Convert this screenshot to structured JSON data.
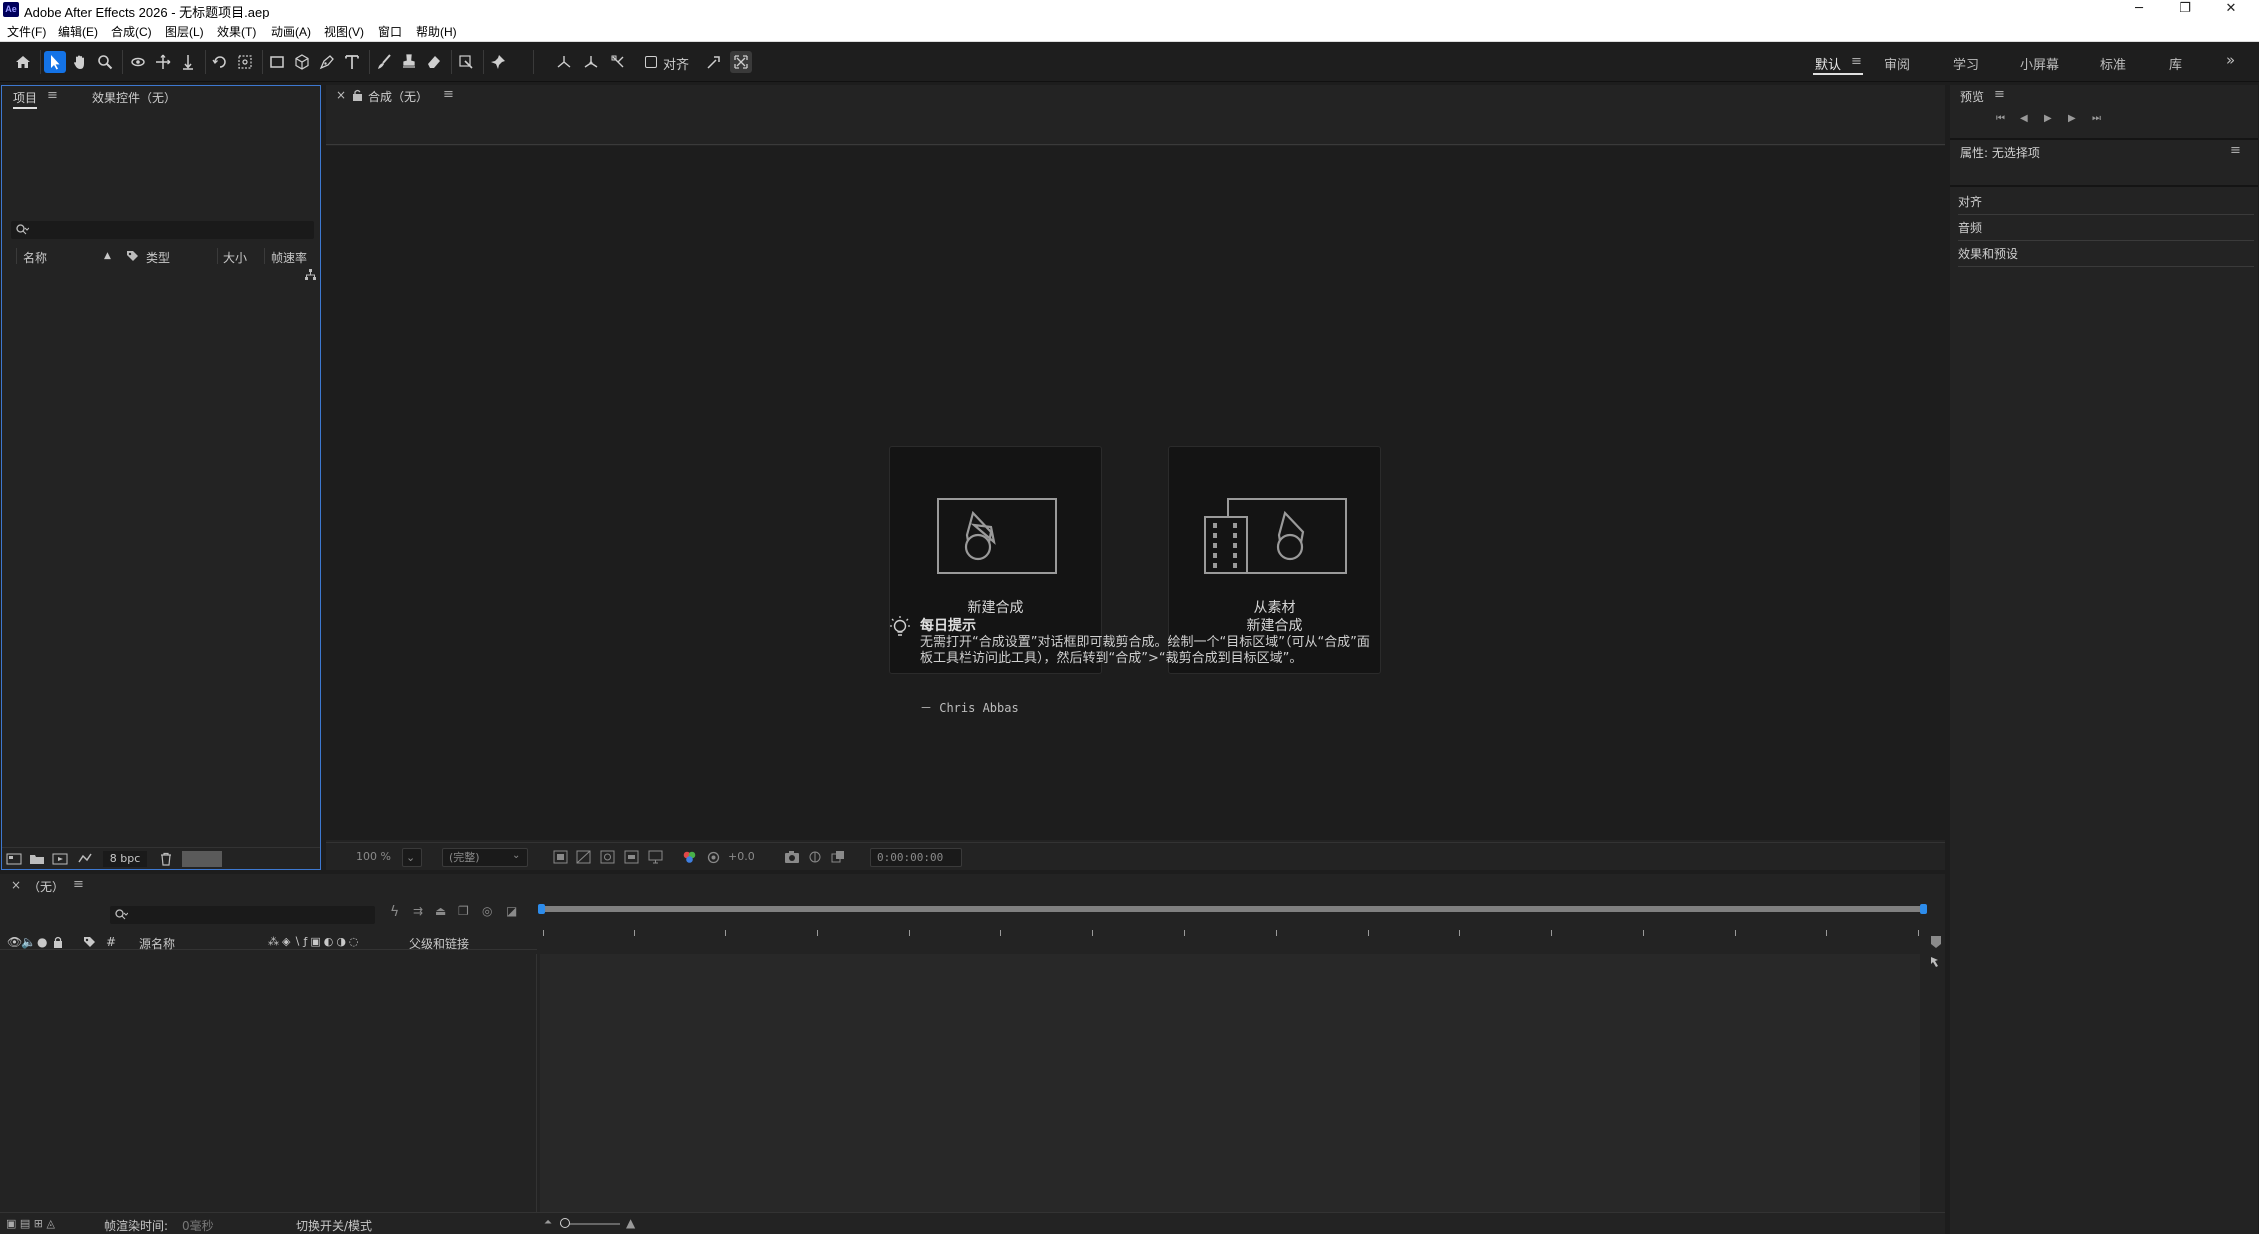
{
  "window": {
    "title": "Adobe After Effects 2026 - 无标题项目.aep",
    "app_icon_text": "Ae",
    "controls": [
      "─",
      "❐",
      "✕"
    ]
  },
  "menu": [
    "文件(F)",
    "编辑(E)",
    "合成(C)",
    "图层(L)",
    "效果(T)",
    "动画(A)",
    "视图(V)",
    "窗口",
    "帮助(H)"
  ],
  "toolbar": {
    "snap_label": "对齐",
    "workspaces": [
      "默认",
      "审阅",
      "学习",
      "小屏幕",
      "标准",
      "库"
    ],
    "active_workspace": "默认",
    "overflow": "»"
  },
  "project_panel": {
    "tabs": [
      "项目",
      "效果控件（无）"
    ],
    "search_placeholder": "",
    "columns": [
      "名称",
      "类型",
      "大小",
      "帧速率"
    ],
    "bpc": "8 bpc"
  },
  "composition_panel": {
    "tab_label": "合成（无）",
    "cards": [
      {
        "label_line1": "新建合成",
        "label_line2": ""
      },
      {
        "label_line1": "从素材",
        "label_line2": "新建合成"
      }
    ],
    "tip": {
      "title": "每日提示",
      "text": "无需打开“合成设置”对话框即可裁剪合成。绘制一个“目标区域”（可从“合成”面板工具栏访问此工具），然后转到“合成”>“裁剪合成到目标区域”。",
      "author": "－ Chris Abbas"
    },
    "viewer_bar": {
      "zoom": "100 %",
      "resolution": "(完整)",
      "exposure": "+0.0",
      "timecode": "0:00:00:00"
    }
  },
  "right_panel": {
    "preview_label": "预览",
    "properties_label": "属性: 无选择项",
    "sections": [
      "对齐",
      "音频",
      "效果和预设"
    ]
  },
  "timeline": {
    "tab_label": "（无）",
    "columns": {
      "hash": "#",
      "source_name": "源名称",
      "parent": "父级和链接"
    },
    "footer": {
      "render_time_label": "帧渲染时间:",
      "render_time_value": "0毫秒",
      "toggle_label": "切换开关/模式"
    }
  },
  "colors": {
    "accent": "#1473e6",
    "panel_bg": "#232323",
    "viewer_bg": "#1d1d1d",
    "card_bg": "#141414",
    "focus_border": "#3d78d0"
  }
}
